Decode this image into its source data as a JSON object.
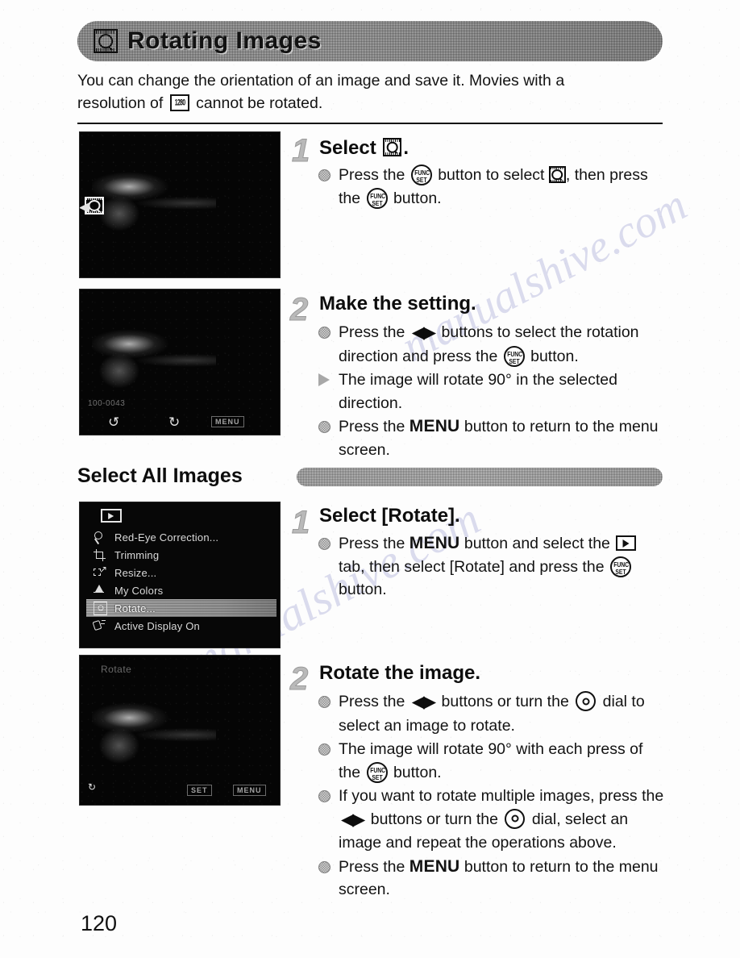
{
  "page": {
    "number": "120",
    "title": "Rotating Images",
    "title_icon": "rotate-icon",
    "intro_part1": "You can change the orientation of an image and save it. Movies with a",
    "intro_part2": "resolution of",
    "intro_icon": "movie-1280-resolution-icon",
    "intro_part3": "cannot be rotated."
  },
  "watermark": {
    "line1": "manualshive.com",
    "line2": "manualshive.com"
  },
  "section_main": {
    "steps": [
      {
        "number": "1",
        "title_prefix": "Select",
        "title_icon": "rotate-icon",
        "title_suffix": ".",
        "bullets": [
          {
            "marker": "dot",
            "segments": [
              {
                "type": "text",
                "value": "Press the "
              },
              {
                "type": "icon",
                "value": "func-set-button-icon"
              },
              {
                "type": "text",
                "value": " button to select "
              },
              {
                "type": "icon",
                "value": "rotate-icon"
              },
              {
                "type": "text",
                "value": ", then press the "
              },
              {
                "type": "icon",
                "value": "func-set-button-icon"
              },
              {
                "type": "text",
                "value": " button."
              }
            ]
          }
        ],
        "screenshot": {
          "name": "camera-lcd-rotate-select",
          "overlay_label": "rotate-icon",
          "caption": ""
        }
      },
      {
        "number": "2",
        "title_prefix": "Make the setting.",
        "title_icon": "",
        "title_suffix": "",
        "bullets": [
          {
            "marker": "dot",
            "segments": [
              {
                "type": "text",
                "value": "Press the "
              },
              {
                "type": "icon",
                "value": "left-right-buttons-icon"
              },
              {
                "type": "text",
                "value": " buttons to select the rotation direction and press the "
              },
              {
                "type": "icon",
                "value": "func-set-button-icon"
              },
              {
                "type": "text",
                "value": " button."
              }
            ]
          },
          {
            "marker": "triangle",
            "segments": [
              {
                "type": "text",
                "value": "The image will rotate 90° in the selected direction."
              }
            ]
          },
          {
            "marker": "dot",
            "segments": [
              {
                "type": "text",
                "value": "Press the "
              },
              {
                "type": "menu",
                "value": "MENU"
              },
              {
                "type": "text",
                "value": " button to return to the menu screen."
              }
            ]
          }
        ],
        "screenshot": {
          "name": "camera-lcd-rotation-direction",
          "overlay_label": "",
          "caption": "MENU"
        }
      }
    ]
  },
  "section_all": {
    "heading": "Select All Images",
    "menu_screen": {
      "tab_icon": "playback-tab-icon",
      "items": [
        {
          "label": "Red-Eye Correction...",
          "icon": "red-eye-icon",
          "selected": false
        },
        {
          "label": "Trimming",
          "icon": "trimming-icon",
          "selected": false
        },
        {
          "label": "Resize...",
          "icon": "resize-icon",
          "selected": false
        },
        {
          "label": "My Colors",
          "icon": "my-colors-icon",
          "selected": false
        },
        {
          "label": "Rotate...",
          "icon": "rotate-icon",
          "selected": true
        },
        {
          "label": "Active Display On",
          "icon": "active-display-icon",
          "selected": false
        }
      ]
    },
    "steps": [
      {
        "number": "1",
        "title_prefix": "Select [Rotate].",
        "title_icon": "",
        "title_suffix": "",
        "bullets": [
          {
            "marker": "dot",
            "segments": [
              {
                "type": "text",
                "value": "Press the "
              },
              {
                "type": "menu",
                "value": "MENU"
              },
              {
                "type": "text",
                "value": " button and select the "
              },
              {
                "type": "icon",
                "value": "playback-tab-icon"
              },
              {
                "type": "text",
                "value": " tab, then select [Rotate] and press the "
              },
              {
                "type": "icon",
                "value": "func-set-button-icon"
              },
              {
                "type": "text",
                "value": " button."
              }
            ]
          }
        ]
      },
      {
        "number": "2",
        "title_prefix": "Rotate the image.",
        "title_icon": "",
        "title_suffix": "",
        "bullets": [
          {
            "marker": "dot",
            "segments": [
              {
                "type": "text",
                "value": "Press the "
              },
              {
                "type": "icon",
                "value": "left-right-buttons-icon"
              },
              {
                "type": "text",
                "value": " buttons or turn the "
              },
              {
                "type": "icon",
                "value": "control-dial-icon"
              },
              {
                "type": "text",
                "value": " dial to select an image to rotate."
              }
            ]
          },
          {
            "marker": "dot",
            "segments": [
              {
                "type": "text",
                "value": "The image will rotate 90° with each press of the "
              },
              {
                "type": "icon",
                "value": "func-set-button-icon"
              },
              {
                "type": "text",
                "value": " button."
              }
            ]
          },
          {
            "marker": "dot",
            "segments": [
              {
                "type": "text",
                "value": "If you want to rotate multiple images, press the "
              },
              {
                "type": "icon",
                "value": "left-right-buttons-icon"
              },
              {
                "type": "text",
                "value": " buttons or turn the "
              },
              {
                "type": "icon",
                "value": "control-dial-icon"
              },
              {
                "type": "text",
                "value": " dial, select an image and repeat the operations above."
              }
            ]
          },
          {
            "marker": "dot",
            "segments": [
              {
                "type": "text",
                "value": "Press the "
              },
              {
                "type": "menu",
                "value": "MENU"
              },
              {
                "type": "text",
                "value": " button to return to the menu screen."
              }
            ]
          }
        ],
        "screenshot": {
          "name": "camera-lcd-rotate-multiple",
          "overlay_label": "Rotate",
          "caption": "MENU"
        }
      }
    ]
  }
}
